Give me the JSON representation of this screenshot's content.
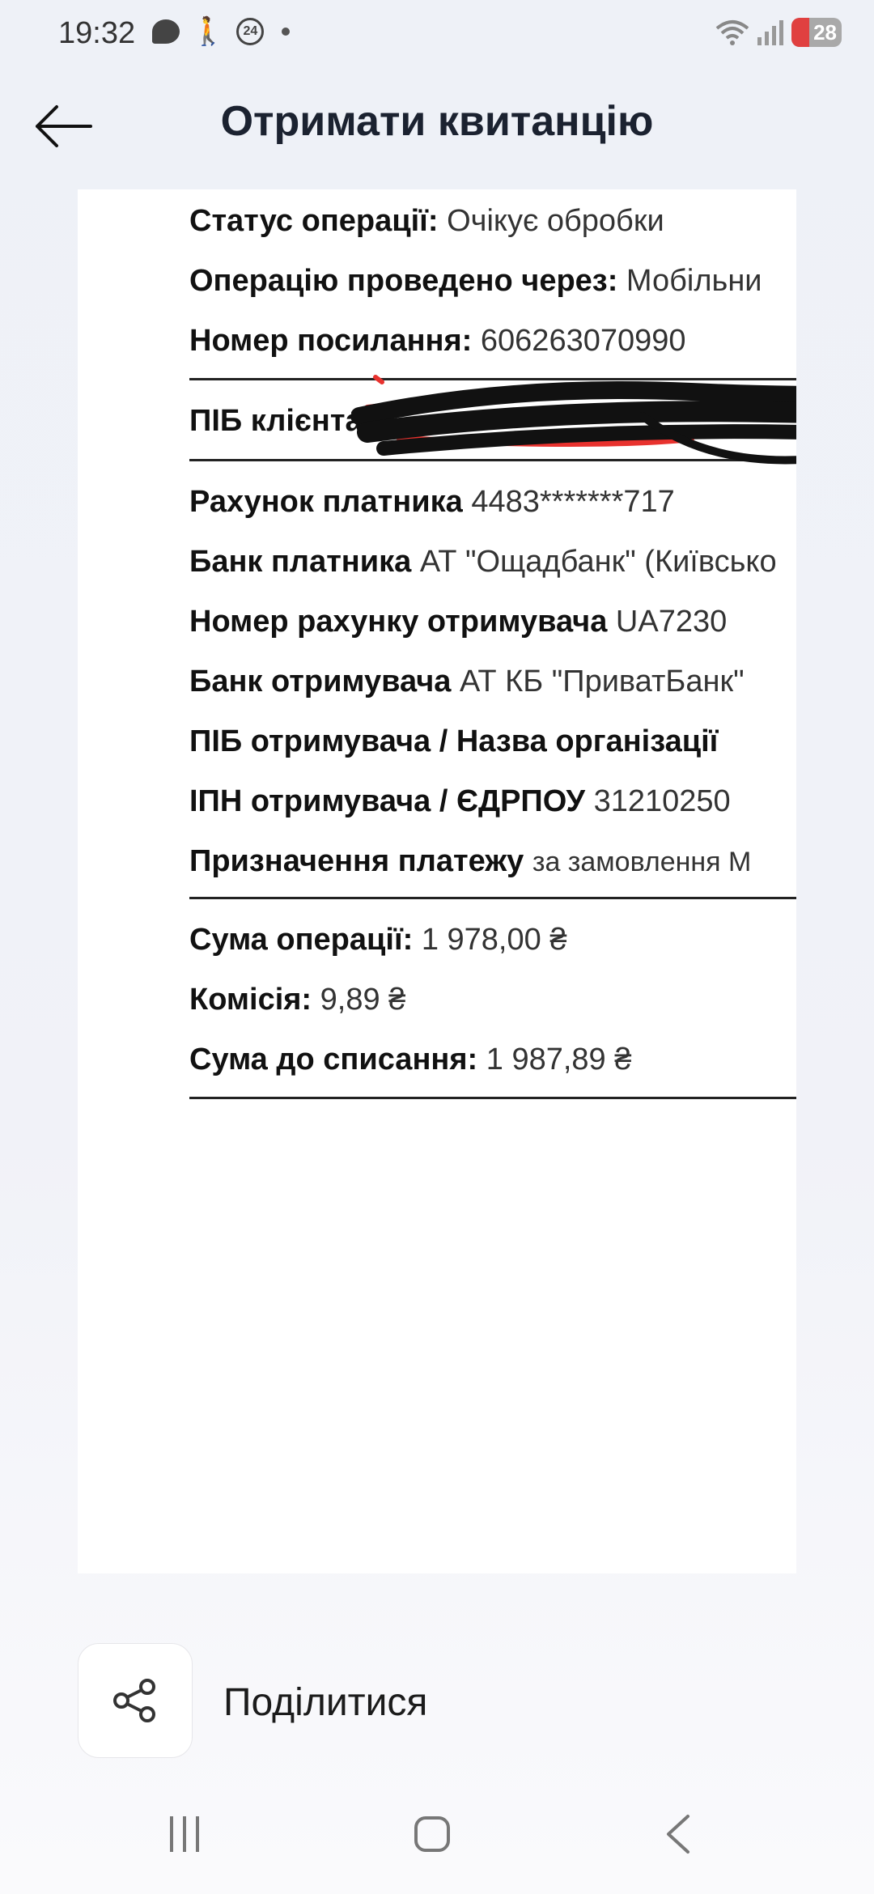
{
  "status_bar": {
    "time": "19:32",
    "icons": [
      "chat-bubble-icon",
      "walking-icon",
      "24-icon",
      "dot-icon",
      "wifi-icon",
      "signal-icon",
      "battery-icon"
    ],
    "battery_level": "28"
  },
  "header": {
    "title": "Отримати квитанцію",
    "back_icon": "arrow-left-icon"
  },
  "receipt": {
    "status": {
      "label": "Статус операції:",
      "value": "Очікує обробки"
    },
    "channel": {
      "label": "Операцію проведено через:",
      "value": "Мобільни"
    },
    "reference": {
      "label": "Номер посилання:",
      "value": "606263070990"
    },
    "client_name": {
      "label": "ПІБ клієнта",
      "value": ""
    },
    "payer_account": {
      "label": "Рахунок платника",
      "value": "4483*******717"
    },
    "payer_bank": {
      "label": "Банк платника",
      "value": "АТ \"Ощадбанк\" (Київсько"
    },
    "recipient_account": {
      "label": "Номер рахунку отримувача",
      "value": "UA7230"
    },
    "recipient_bank": {
      "label": "Банк отримувача",
      "value": "АТ КБ \"ПриватБанк\""
    },
    "recipient_name": {
      "label": "ПІБ отримувача / Назва організації",
      "value": ""
    },
    "recipient_code": {
      "label": "ІПН отримувача / ЄДРПОУ",
      "value": "31210250"
    },
    "purpose": {
      "label": "Призначення платежу",
      "value": "за замовлення М"
    },
    "amount": {
      "label": "Сума операції:",
      "value": "1 978,00 ₴"
    },
    "fee": {
      "label": "Комісія:",
      "value": "9,89 ₴"
    },
    "total": {
      "label": "Сума до списання:",
      "value": "1 987,89 ₴"
    }
  },
  "share": {
    "label": "Поділитися",
    "icon": "share-icon"
  },
  "navbar": {
    "icons": [
      "recents-icon",
      "home-icon",
      "back-icon"
    ]
  },
  "colors": {
    "title": "#1b2230",
    "redaction_black": "#111111",
    "redaction_red": "#e8322e"
  }
}
